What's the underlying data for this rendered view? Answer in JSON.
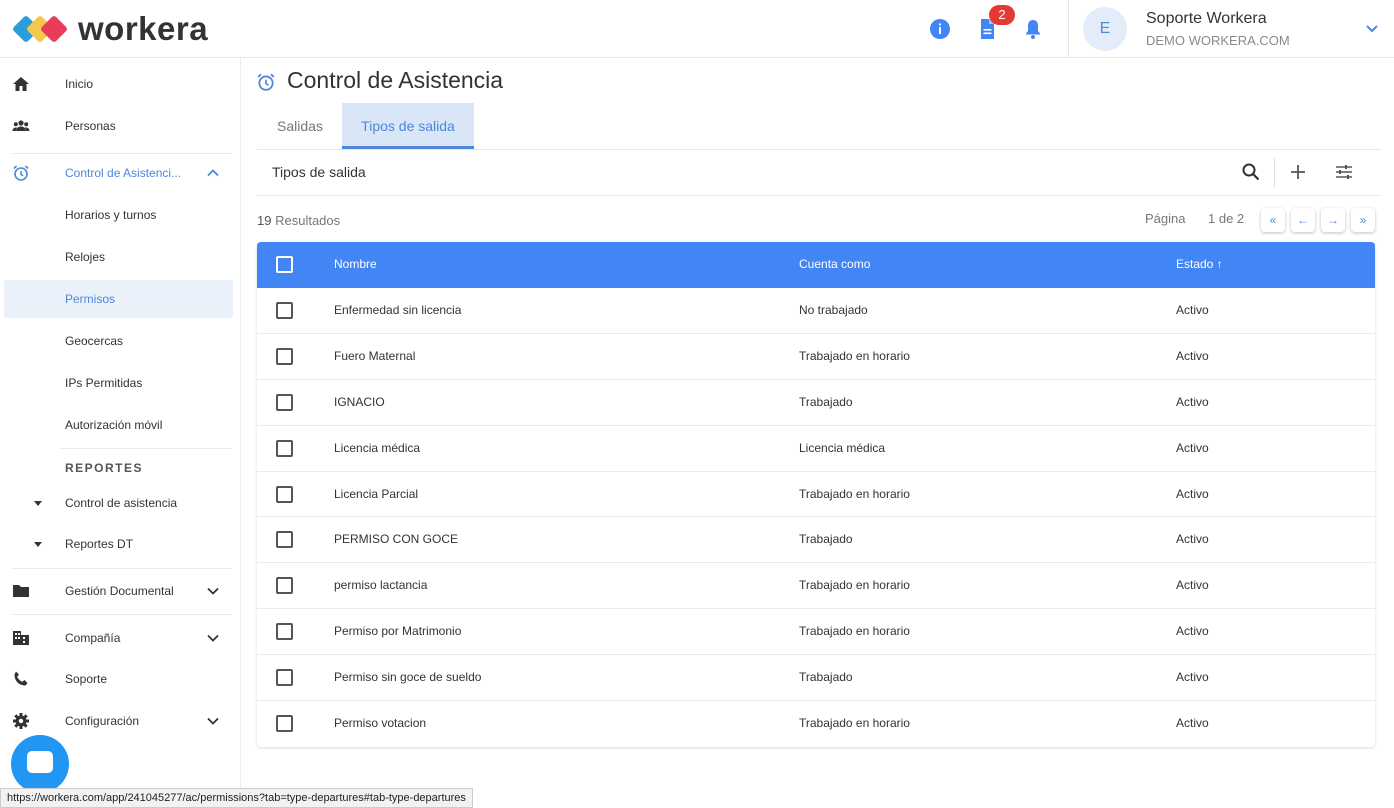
{
  "header": {
    "logo_text": "workera",
    "notification_count": "2",
    "user_initial": "E",
    "user_name": "Soporte Workera",
    "user_company": "DEMO WORKERA.COM",
    "icons": [
      "info-icon",
      "document-icon",
      "bell-icon",
      "chevron-down-icon"
    ],
    "accent_color": "#4285f4"
  },
  "sidebar": {
    "items": [
      {
        "label": "Inicio",
        "icon": "home-icon"
      },
      {
        "label": "Personas",
        "icon": "people-icon"
      },
      {
        "label": "Control de Asistenci...",
        "icon": "alarm-icon"
      },
      {
        "label": "Horarios y turnos"
      },
      {
        "label": "Relojes"
      },
      {
        "label": "Permisos"
      },
      {
        "label": "Geocercas"
      },
      {
        "label": "IPs Permitidas"
      },
      {
        "label": "Autorización móvil"
      },
      {
        "label": "Control de asistencia"
      },
      {
        "label": "Reportes DT"
      },
      {
        "label": "Gestión Documental",
        "icon": "folder-icon"
      },
      {
        "label": "Compañía",
        "icon": "building-icon"
      },
      {
        "label": "Soporte",
        "icon": "phone-icon"
      },
      {
        "label": "Configuración",
        "icon": "gear-icon"
      }
    ],
    "reports_title": "REPORTES"
  },
  "main": {
    "title": "Control de Asistencia",
    "tabs": [
      {
        "label": "Salidas"
      },
      {
        "label": "Tipos de salida"
      }
    ],
    "toolbar_title": "Tipos de salida",
    "results_count": "19",
    "results_label": "Resultados",
    "page_label": "Página",
    "page_value": "1 de 2",
    "pagination": [
      "«",
      "←",
      "→",
      "»"
    ]
  },
  "table": {
    "columns": [
      "Nombre",
      "Cuenta como",
      "Estado"
    ],
    "rows": [
      [
        "Enfermedad sin licencia",
        "No trabajado",
        "Activo"
      ],
      [
        "Fuero Maternal",
        "Trabajado en horario",
        "Activo"
      ],
      [
        "IGNACIO",
        "Trabajado",
        "Activo"
      ],
      [
        "Licencia médica",
        "Licencia médica",
        "Activo"
      ],
      [
        "Licencia Parcial",
        "Trabajado en horario",
        "Activo"
      ],
      [
        "PERMISO CON GOCE",
        "Trabajado",
        "Activo"
      ],
      [
        "permiso lactancia",
        "Trabajado en horario",
        "Activo"
      ],
      [
        "Permiso por Matrimonio",
        "Trabajado en horario",
        "Activo"
      ],
      [
        "Permiso sin goce de sueldo",
        "Trabajado",
        "Activo"
      ],
      [
        "Permiso votacion",
        "Trabajado en horario",
        "Activo"
      ]
    ]
  },
  "status_bar_url": "https://workera.com/app/241045277/ac/permissions?tab=type-departures#tab-type-departures"
}
